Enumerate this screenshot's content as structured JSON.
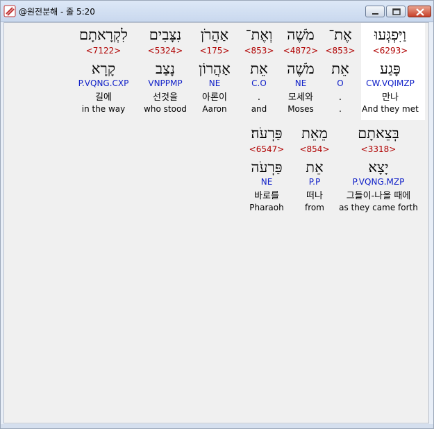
{
  "window": {
    "title": "@원전분해 - 줄 5:20"
  },
  "icons": {
    "app": "app-logo-icon",
    "minimize": "minimize-icon",
    "maximize": "maximize-icon",
    "close": "close-icon"
  },
  "colors": {
    "strong": "#b00000",
    "parse": "#1020c8",
    "highlight": "#ffffff"
  },
  "words": [
    {
      "hebrew": "וַיִּפְגְּעוּ",
      "strong": "<6293>",
      "lemma": "פָּגַע",
      "parse": "CW.VQIMZP",
      "korean": "만나",
      "english": "And they met",
      "selected": true
    },
    {
      "hebrew": "אֶת־",
      "strong": "<853>",
      "lemma": "אֵת",
      "parse": "O",
      "korean": ".",
      "english": "."
    },
    {
      "hebrew": "מֹשֶׁה",
      "strong": "<4872>",
      "lemma": "מֹשֶׁה",
      "parse": "NE",
      "korean": "모세와",
      "english": "Moses"
    },
    {
      "hebrew": "וְאֶת־",
      "strong": "<853>",
      "lemma": "אֵת",
      "parse": "C.O",
      "korean": ".",
      "english": "and"
    },
    {
      "hebrew": "אַהֲרֹן",
      "strong": "<175>",
      "lemma": "אַהֲרוֹן",
      "parse": "NE",
      "korean": "아론이",
      "english": "Aaron"
    },
    {
      "hebrew": "נִצָּבִים",
      "strong": "<5324>",
      "lemma": "נָצַב",
      "parse": "VNPPMP",
      "korean": "선것을",
      "english": "who stood"
    },
    {
      "hebrew": "לִקְרָאתָם",
      "strong": "<7122>",
      "lemma": "קָרָא",
      "parse": "P.VQNG.CXP",
      "korean": "길에",
      "english": "in the way"
    },
    {
      "hebrew": "בְּצֵאתָם",
      "strong": "<3318>",
      "lemma": "יָצָא",
      "parse": "P.VQNG.MZP",
      "korean": "그들이-나올 때에",
      "english": "as they came forth"
    },
    {
      "hebrew": "מֵאֵת",
      "strong": "<854>",
      "lemma": "אֵת",
      "parse": "P.P",
      "korean": "떠나",
      "english": "from"
    },
    {
      "hebrew": "פַּרְעֹה׃",
      "strong": "<6547>",
      "lemma": "פַּרְעֹה",
      "parse": "NE",
      "korean": "바로를",
      "english": "Pharaoh"
    }
  ]
}
